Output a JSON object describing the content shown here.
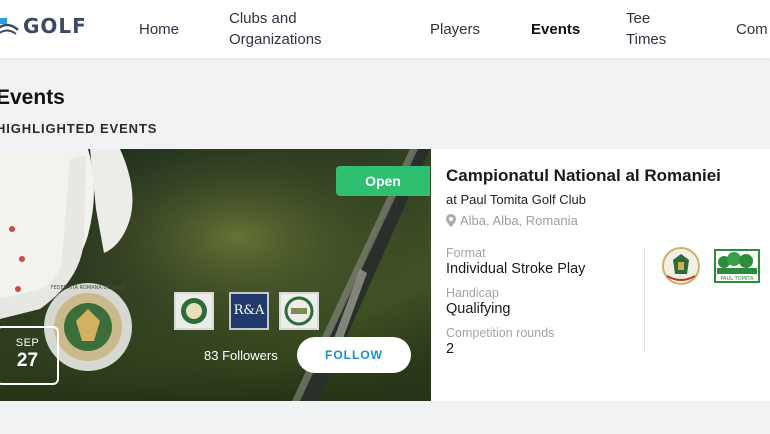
{
  "header": {
    "logo_text": "GOLF",
    "nav": [
      {
        "label": "Home"
      },
      {
        "label": "Clubs and Organizations"
      },
      {
        "label": "Players"
      },
      {
        "label": "Events",
        "active": true
      },
      {
        "label": "Tee Times"
      },
      {
        "label": "Com"
      }
    ]
  },
  "page": {
    "title": "Events",
    "section_title": "HIGHLIGHTED EVENTS"
  },
  "event": {
    "status": "Open",
    "date_month": "SEP",
    "date_day": "27",
    "followers": "83 Followers",
    "follow_label": "FOLLOW",
    "title": "Campionatul National al Romaniei",
    "venue": "at Paul Tomita Golf Club",
    "location": "Alba, Alba, Romania",
    "details": [
      {
        "label": "Format",
        "value": "Individual Stroke Play"
      },
      {
        "label": "Handicap",
        "value": "Qualifying"
      },
      {
        "label": "Competition rounds",
        "value": "2"
      }
    ],
    "sponsors": [
      "R&A"
    ],
    "org_logos": [
      "federation-logo",
      "club-logo"
    ],
    "org_logo_text": "PAUL TOMITA",
    "ball_text": "FEDERATIA ROMANA DE GOLF"
  },
  "colors": {
    "accent": "#1f8ecf",
    "status_open": "#2fbf71",
    "brand": "#3b4a63"
  }
}
